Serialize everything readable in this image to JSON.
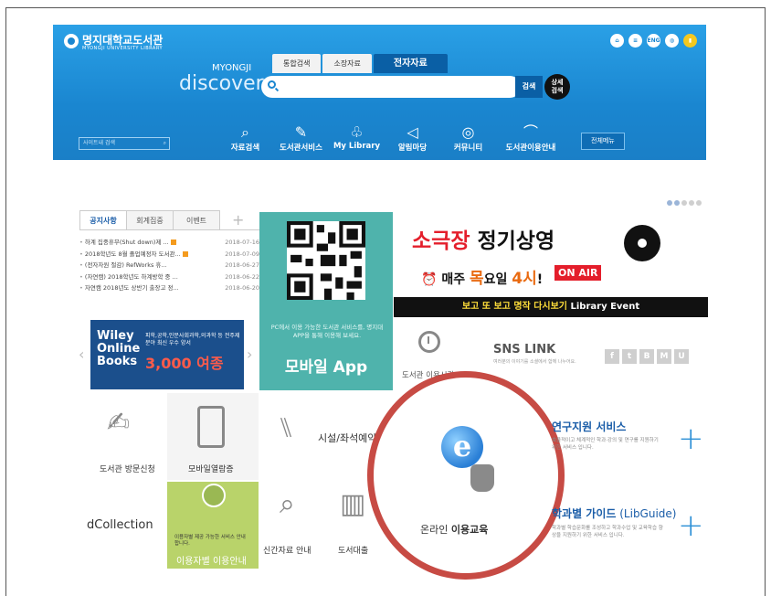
{
  "header": {
    "logo_name": "명지대학교도서관",
    "logo_sub": "MYONGJI UNIVERSITY LIBRARY",
    "brand_top": "MYONGJI",
    "brand_main": "discovery",
    "search_tabs": [
      "통합검색",
      "소장자료",
      "전자자료"
    ],
    "search_button": "검색",
    "advanced_button": "상세\n검색",
    "site_search_placeholder": "사이트내 검색",
    "top_icons": [
      "home-icon",
      "list-icon",
      "ENG",
      "globe-icon",
      "lock-icon"
    ],
    "top_eng": "ENG",
    "nav": [
      {
        "label": "자료검색",
        "icon": "search-icon"
      },
      {
        "label": "도서관서비스",
        "icon": "pen-icon"
      },
      {
        "label": "My Library",
        "icon": "plant-icon"
      },
      {
        "label": "알림마당",
        "icon": "megaphone-icon"
      },
      {
        "label": "커뮤니티",
        "icon": "chat-icon"
      },
      {
        "label": "도서관이용안내",
        "icon": "book-icon"
      }
    ],
    "all_menu": "전체메뉴"
  },
  "notice": {
    "tabs": [
      "공지사항",
      "회계집중",
      "이벤트"
    ],
    "plus": "+",
    "rows": [
      {
        "title": "하계 집중휴무(Shut down)제 ...",
        "date": "2018-07-16",
        "new": true
      },
      {
        "title": "2018학년도 8월 졸업예정자 도서관...",
        "date": "2018-07-09",
        "new": true
      },
      {
        "title": "(전자자원 절감) RefWorks 휴...",
        "date": "2018-06-27",
        "new": false
      },
      {
        "title": "(자연캠) 2018학년도 하계방학 중 ...",
        "date": "2018-06-22",
        "new": false
      },
      {
        "title": "자연캠 2018년도 상반기 출장고 정...",
        "date": "2018-06-20",
        "new": false
      }
    ]
  },
  "wiley": {
    "logo": "Wiley Online Books",
    "desc": "피학,공학,인문사회과학,의과학 등 전주제분야 최신 우수 양서",
    "count": "3,000 여종"
  },
  "mobile_app": {
    "desc": "PC에서 이용 가능한 도서관 서비스를, 명지대 APP을 통해 이용해 보세요.",
    "title": "모바일 App"
  },
  "theater": {
    "title_red": "소극장",
    "title_black": " 정기상영",
    "weekly_1": "매주 ",
    "weekly_day": "목",
    "weekly_2": "요일 ",
    "weekly_time": "4시",
    "weekly_3": "!",
    "onair": "ON AIR",
    "band_yellow": "보고 또 보고 명작 다시보기",
    "band_white": " Library Event"
  },
  "hours": {
    "label": "도서관 이용시간"
  },
  "sns": {
    "title": "SNS LINK",
    "desc": "여러분의 이야기를 소셜에서 함께 나누어요.",
    "icons": [
      "f",
      "t",
      "B",
      "M",
      "U"
    ]
  },
  "quick": {
    "visit": "도서관 방문신청",
    "mobile_card": "모바일열람증",
    "facility": "시설/좌석예약",
    "new_books": "신간자료 안내",
    "loan": "도서대출",
    "dcollection": "dCollection",
    "user_guide_desc": "이용자별 제공 가능한 서비스 안내 합니다.",
    "user_guide": "이용자별 이용안내",
    "online_edu_1": "온라인 ",
    "online_edu_2": "이용교육"
  },
  "research": {
    "title": "연구지원 서비스",
    "desc": "효율적이고 체계적인 학과·강의 및 연구를 지원하기 위한 서비스 입니다.",
    "plus": "+"
  },
  "libguide": {
    "title": "학과별 가이드",
    "title_light": " (LibGuide)",
    "desc": "학과별 학습문화를 조성하고 학과수업 및 교육학습 향상을 지원하기 위한 서비스 입니다.",
    "plus": "+"
  },
  "colors": {
    "header_blue": "#1a86d0",
    "accent_red": "#e41e2b",
    "teal": "#4fb3ac",
    "circle": "#c74b44"
  }
}
